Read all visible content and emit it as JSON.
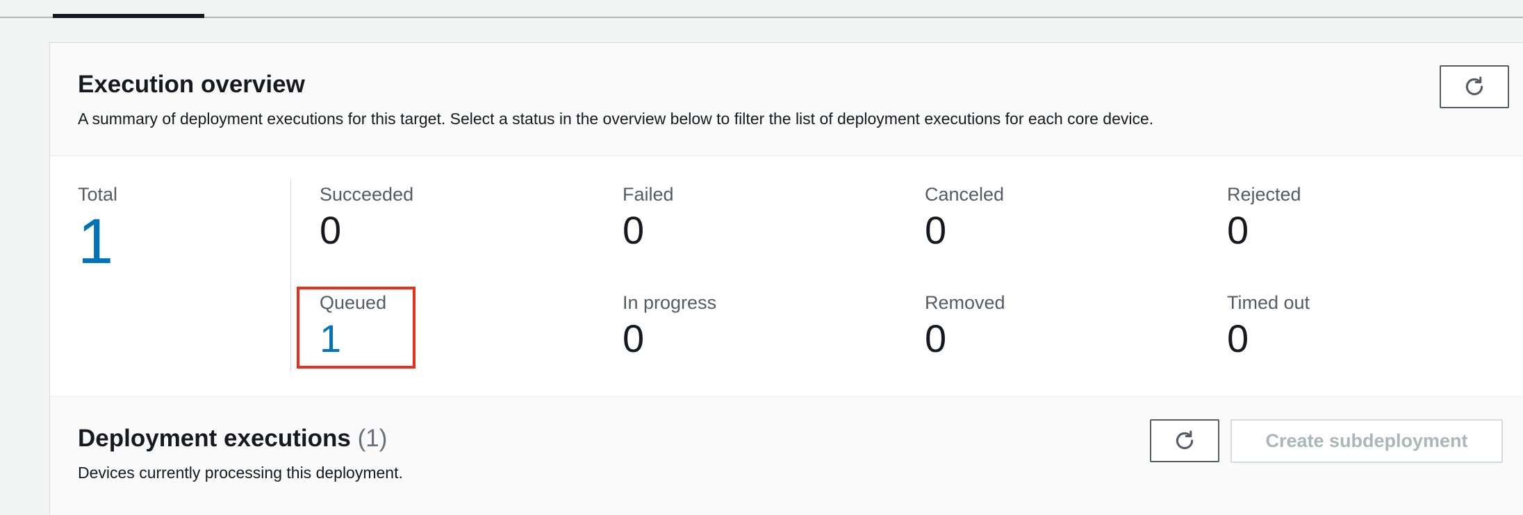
{
  "overview": {
    "title": "Execution overview",
    "description": "A summary of deployment executions for this target. Select a status in the overview below to filter the list of deployment executions for each core device.",
    "refresh_icon": "refresh-icon",
    "total": {
      "label": "Total",
      "value": "1"
    },
    "statuses": [
      {
        "label": "Succeeded",
        "value": "0"
      },
      {
        "label": "Failed",
        "value": "0"
      },
      {
        "label": "Canceled",
        "value": "0"
      },
      {
        "label": "Rejected",
        "value": "0"
      },
      {
        "label": "Queued",
        "value": "1"
      },
      {
        "label": "In progress",
        "value": "0"
      },
      {
        "label": "Removed",
        "value": "0"
      },
      {
        "label": "Timed out",
        "value": "0"
      }
    ]
  },
  "executions": {
    "title": "Deployment executions",
    "count": "(1)",
    "description": "Devices currently processing this deployment.",
    "refresh_icon": "refresh-icon",
    "create_label": "Create subdeployment"
  },
  "colors": {
    "link": "#0073bb",
    "highlight": "#e8301e",
    "disabled": "#aab7b8"
  }
}
